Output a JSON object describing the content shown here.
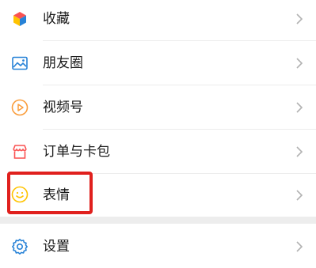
{
  "menu": {
    "items": [
      {
        "label": "收藏",
        "icon": "favorites-cube-icon"
      },
      {
        "label": "朋友圈",
        "icon": "moments-image-icon"
      },
      {
        "label": "视频号",
        "icon": "channels-play-icon"
      },
      {
        "label": "订单与卡包",
        "icon": "cards-shop-icon"
      },
      {
        "label": "表情",
        "icon": "sticker-smile-icon"
      },
      {
        "label": "设置",
        "icon": "settings-gear-icon"
      }
    ]
  },
  "highlight": {
    "target": "表情",
    "color": "#e0201d"
  },
  "colors": {
    "divider": "#ececec",
    "section_gap": "#ededed",
    "chevron": "#b2b2b2"
  }
}
